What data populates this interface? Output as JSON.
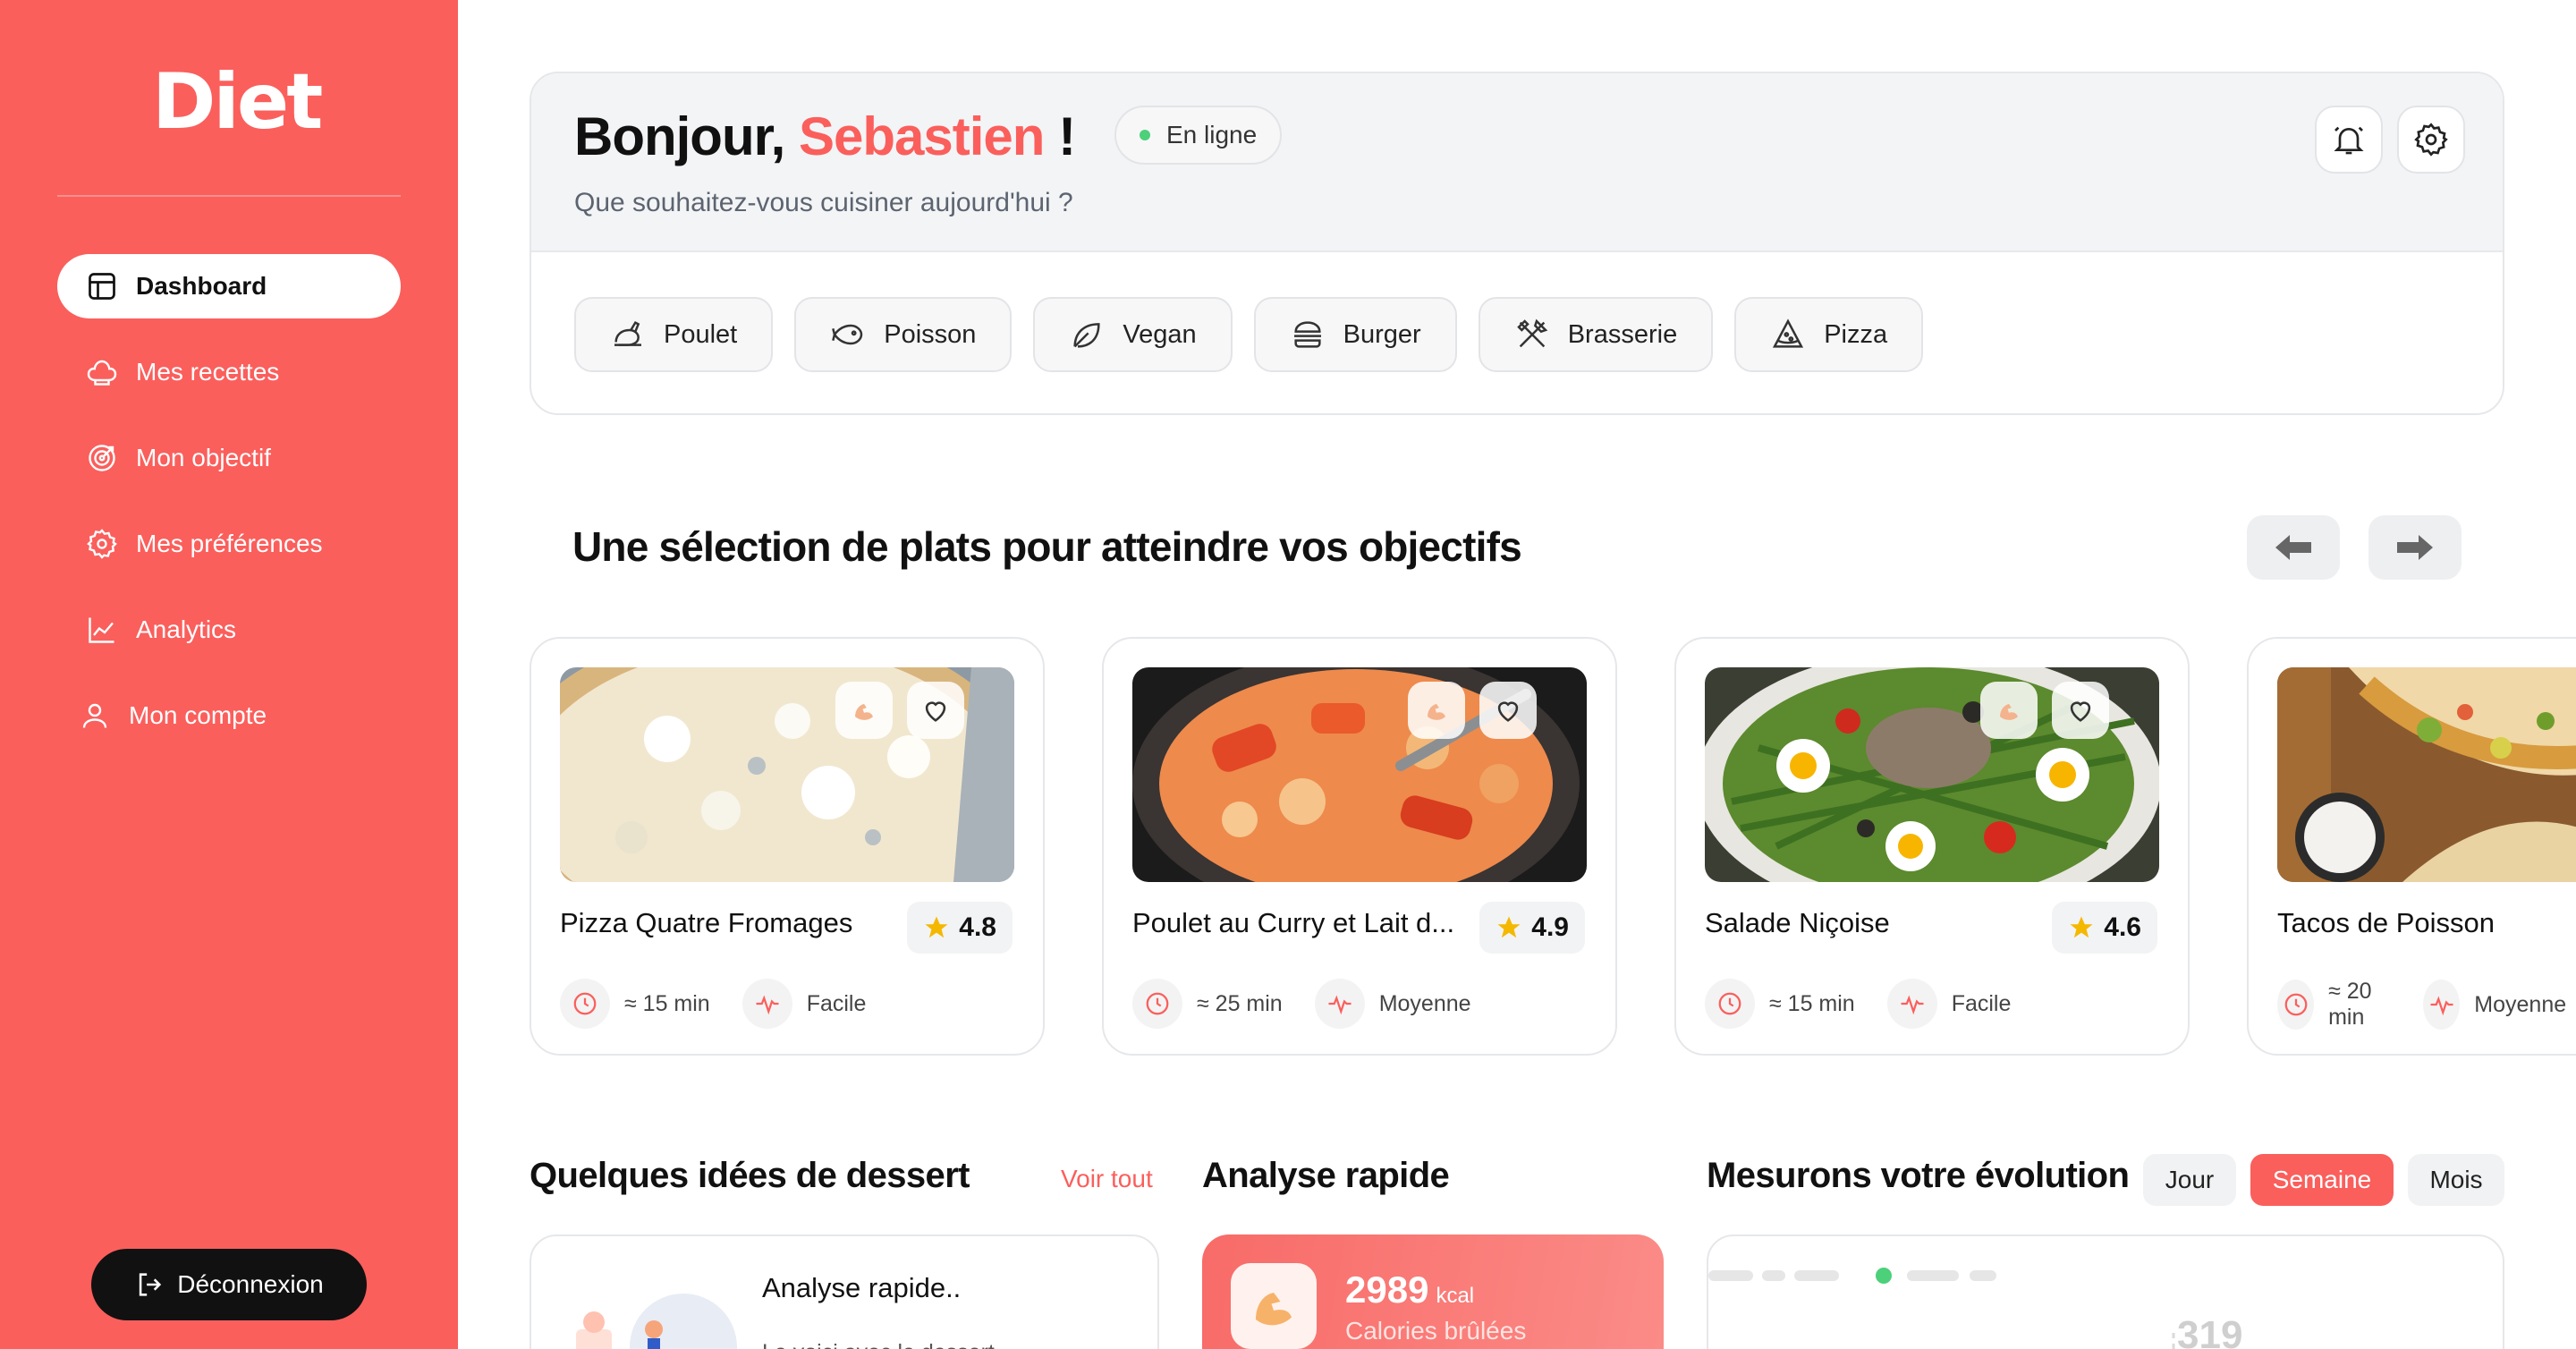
{
  "app": {
    "logo": "Diet"
  },
  "sidebar": {
    "items": [
      {
        "label": "Dashboard",
        "icon": "layout-icon",
        "active": true
      },
      {
        "label": "Mes recettes",
        "icon": "chef-hat-icon"
      },
      {
        "label": "Mon objectif",
        "icon": "target-icon"
      },
      {
        "label": "Mes préférences",
        "icon": "gear-icon"
      },
      {
        "label": "Analytics",
        "icon": "line-chart-icon"
      },
      {
        "label": "Mon compte",
        "icon": "user-icon"
      }
    ],
    "logout_label": "Déconnexion"
  },
  "header": {
    "greeting_prefix": "Bonjour,",
    "user_name": "Sebastien",
    "greeting_suffix": "!",
    "status": "En ligne",
    "subtitle": "Que souhaitez-vous cuisiner aujourd'hui ?",
    "categories": [
      {
        "label": "Poulet",
        "icon": "chicken-icon"
      },
      {
        "label": "Poisson",
        "icon": "fish-icon"
      },
      {
        "label": "Vegan",
        "icon": "leaf-icon"
      },
      {
        "label": "Burger",
        "icon": "burger-icon"
      },
      {
        "label": "Brasserie",
        "icon": "utensils-icon"
      },
      {
        "label": "Pizza",
        "icon": "pizza-icon"
      }
    ]
  },
  "selection": {
    "title": "Une sélection de plats pour atteindre vos objectifs",
    "recipes": [
      {
        "name": "Pizza Quatre Fromages",
        "rating": "4.8",
        "time": "≈ 15 min",
        "difficulty": "Facile"
      },
      {
        "name": "Poulet au Curry et Lait d...",
        "rating": "4.9",
        "time": "≈ 25 min",
        "difficulty": "Moyenne"
      },
      {
        "name": "Salade Niçoise",
        "rating": "4.6",
        "time": "≈ 15 min",
        "difficulty": "Facile"
      },
      {
        "name": "Tacos de Poisson",
        "rating": "",
        "time": "≈ 20 min",
        "difficulty": "Moyenne"
      }
    ]
  },
  "desserts": {
    "title": "Quelques idées de dessert",
    "see_all": "Voir tout",
    "card_title": "Analyse rapide..",
    "card_desc": "Le voici avec le dessert..."
  },
  "quick": {
    "title": "Analyse rapide",
    "kcal_value": "2989",
    "kcal_unit": "kcal",
    "kcal_label": "Calories brûlées"
  },
  "evolution": {
    "title": "Mesurons votre évolution",
    "periods": [
      "Jour",
      "Semaine",
      "Mois"
    ],
    "active_period": "Semaine",
    "value": "319"
  },
  "colors": {
    "accent": "#fa5f5c",
    "sidebar": "#fa5f5c",
    "online": "#4cd07a",
    "star": "#f5b800"
  }
}
